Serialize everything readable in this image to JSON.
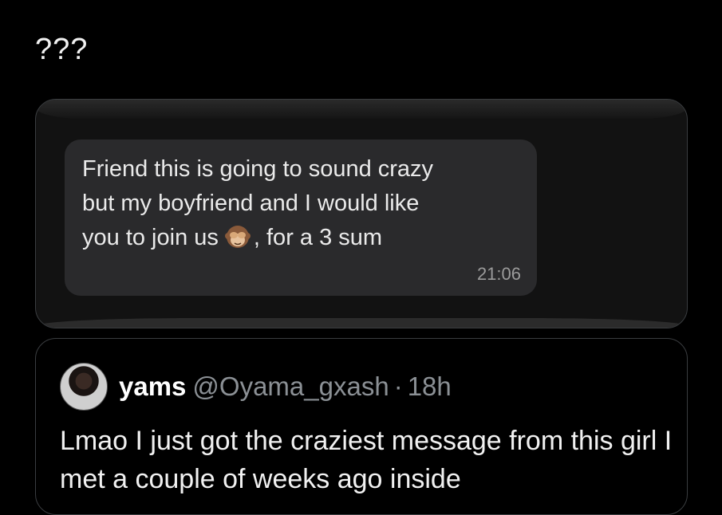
{
  "tweet": {
    "text": "???"
  },
  "media": {
    "chat_lines": [
      "Friend this is going to sound crazy",
      "but my boyfriend and I would like",
      "you to join us",
      ", for a 3 sum"
    ],
    "emoji_icon": "see-no-evil-monkey-icon",
    "time": "21:06"
  },
  "quote": {
    "name": "yams",
    "handle": "@Oyama_gxash",
    "separator": "·",
    "time": "18h",
    "text": "Lmao I just got the craziest message from this girl I met a couple of weeks ago inside"
  },
  "colors": {
    "background": "#000000",
    "bubble": "#2a2a2c",
    "muted_text": "#8b9095",
    "border": "#3a3d40"
  }
}
